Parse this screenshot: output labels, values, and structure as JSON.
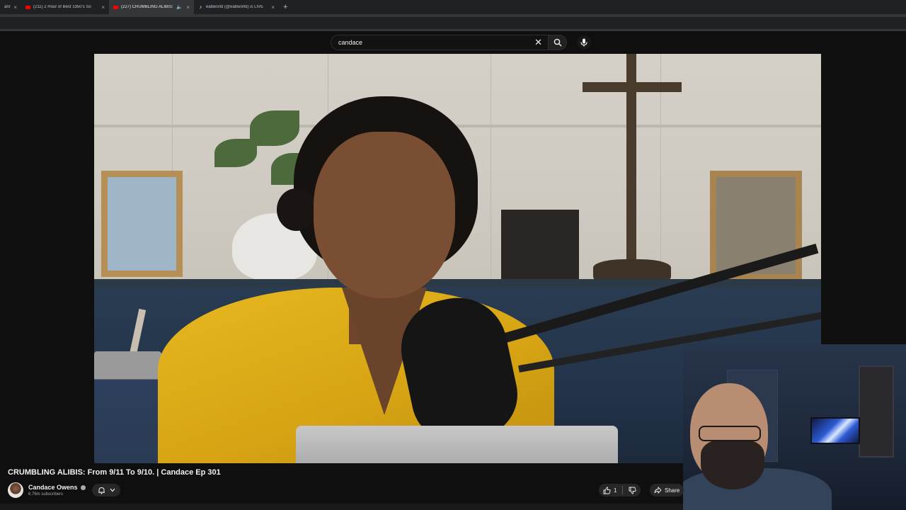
{
  "browser": {
    "tabs": [
      {
        "title": "anri",
        "favicon": "none",
        "active": false
      },
      {
        "title": "(211) 2 Hour of Best 1950's So",
        "favicon": "youtube-icon",
        "active": false
      },
      {
        "title": "(227) CRUMBLING ALIBIS: F",
        "favicon": "youtube-icon",
        "active": true,
        "audio": true
      },
      {
        "title": "eabworld (@eabworld) is LIVE",
        "favicon": "tiktok-icon",
        "active": false
      }
    ],
    "new_tab_label": "+",
    "close_glyph": "×"
  },
  "search": {
    "value": "candace",
    "placeholder": "Search"
  },
  "video": {
    "title": "CRUMBLING ALIBIS: From 9/11 To 9/10. | Candace Ep 301"
  },
  "channel": {
    "name": "Candace Owens",
    "subscribers": "6.76m subscribers",
    "verified": true
  },
  "actions": {
    "like_count": "1",
    "share_label": "Share"
  },
  "colors": {
    "youtube_red": "#ff0000",
    "background": "#0f0f0f",
    "button_bg": "#272727",
    "text": "#f1f1f1",
    "secondary_text": "#aaaaaa"
  }
}
